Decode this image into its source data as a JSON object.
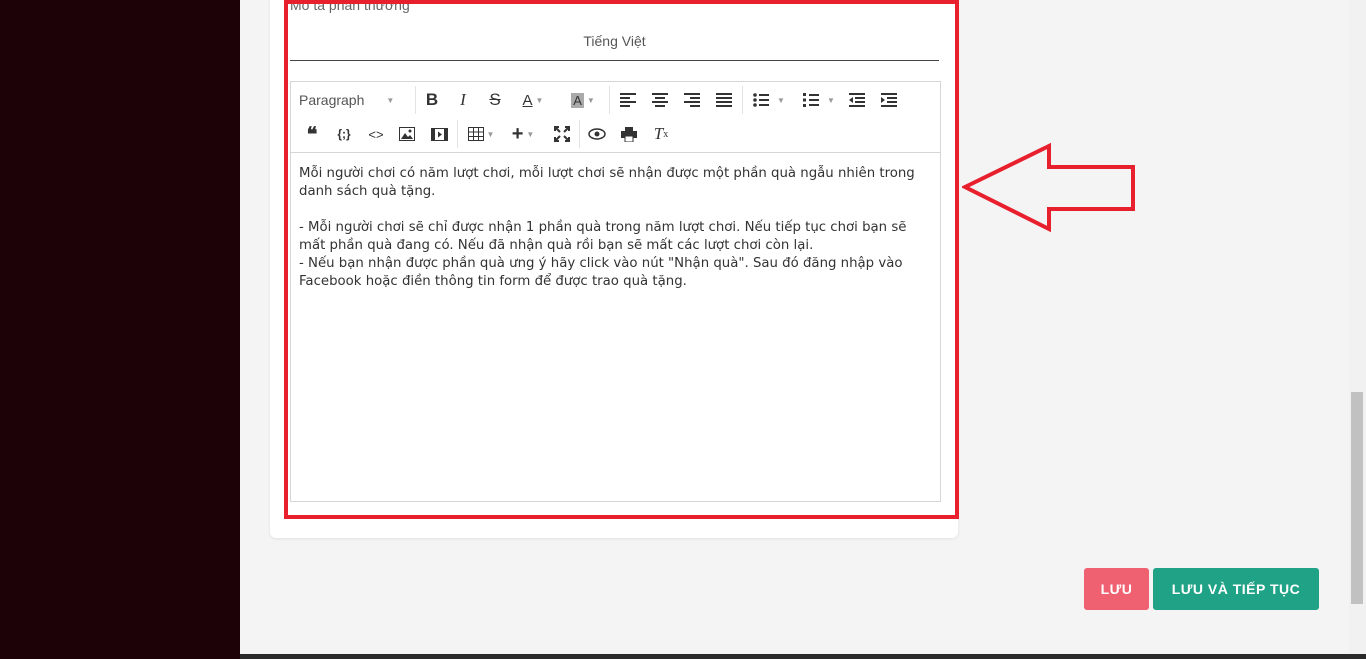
{
  "form": {
    "field_label": "Mô tả phần thưởng",
    "language_tab": "Tiếng Việt"
  },
  "editor": {
    "toolbar": {
      "paragraph_select": "Paragraph",
      "icons": [
        "bold-icon",
        "italic-icon",
        "strikethrough-icon",
        "font-color-icon",
        "background-color-icon",
        "align-left-icon",
        "align-center-icon",
        "align-right-icon",
        "align-justify-icon",
        "bulleted-list-icon",
        "numbered-list-icon",
        "outdent-icon",
        "indent-icon",
        "quote-icon",
        "code-block-icon",
        "inline-code-icon",
        "image-icon",
        "video-icon",
        "table-icon",
        "insert-more-icon",
        "fullscreen-icon",
        "preview-icon",
        "print-icon",
        "clear-format-icon"
      ]
    },
    "content": [
      "Mỗi người chơi có năm lượt chơi, mỗi lượt chơi sẽ nhận được một phần quà ngẫu nhiên trong danh sách quà tặng.",
      "",
      "- Mỗi người chơi sẽ chỉ được nhận 1 phần quà trong năm lượt chơi. Nếu tiếp tục chơi bạn sẽ mất phần quà đang có. Nếu đã nhận quà rồi bạn sẽ mất các lượt chơi còn lại.",
      "- Nếu bạn nhận được phần quà ưng ý hãy click vào nút \"Nhận quà\". Sau đó đăng nhập vào Facebook hoặc điền thông tin form để được trao quà tặng."
    ]
  },
  "buttons": {
    "save": "LƯU",
    "save_continue": "LƯU VÀ TIẾP TỤC"
  },
  "colors": {
    "sidebar": "#1d0307",
    "highlight": "#e8202e",
    "save_button": "#ef6071",
    "save_continue_button": "#1fa285"
  }
}
